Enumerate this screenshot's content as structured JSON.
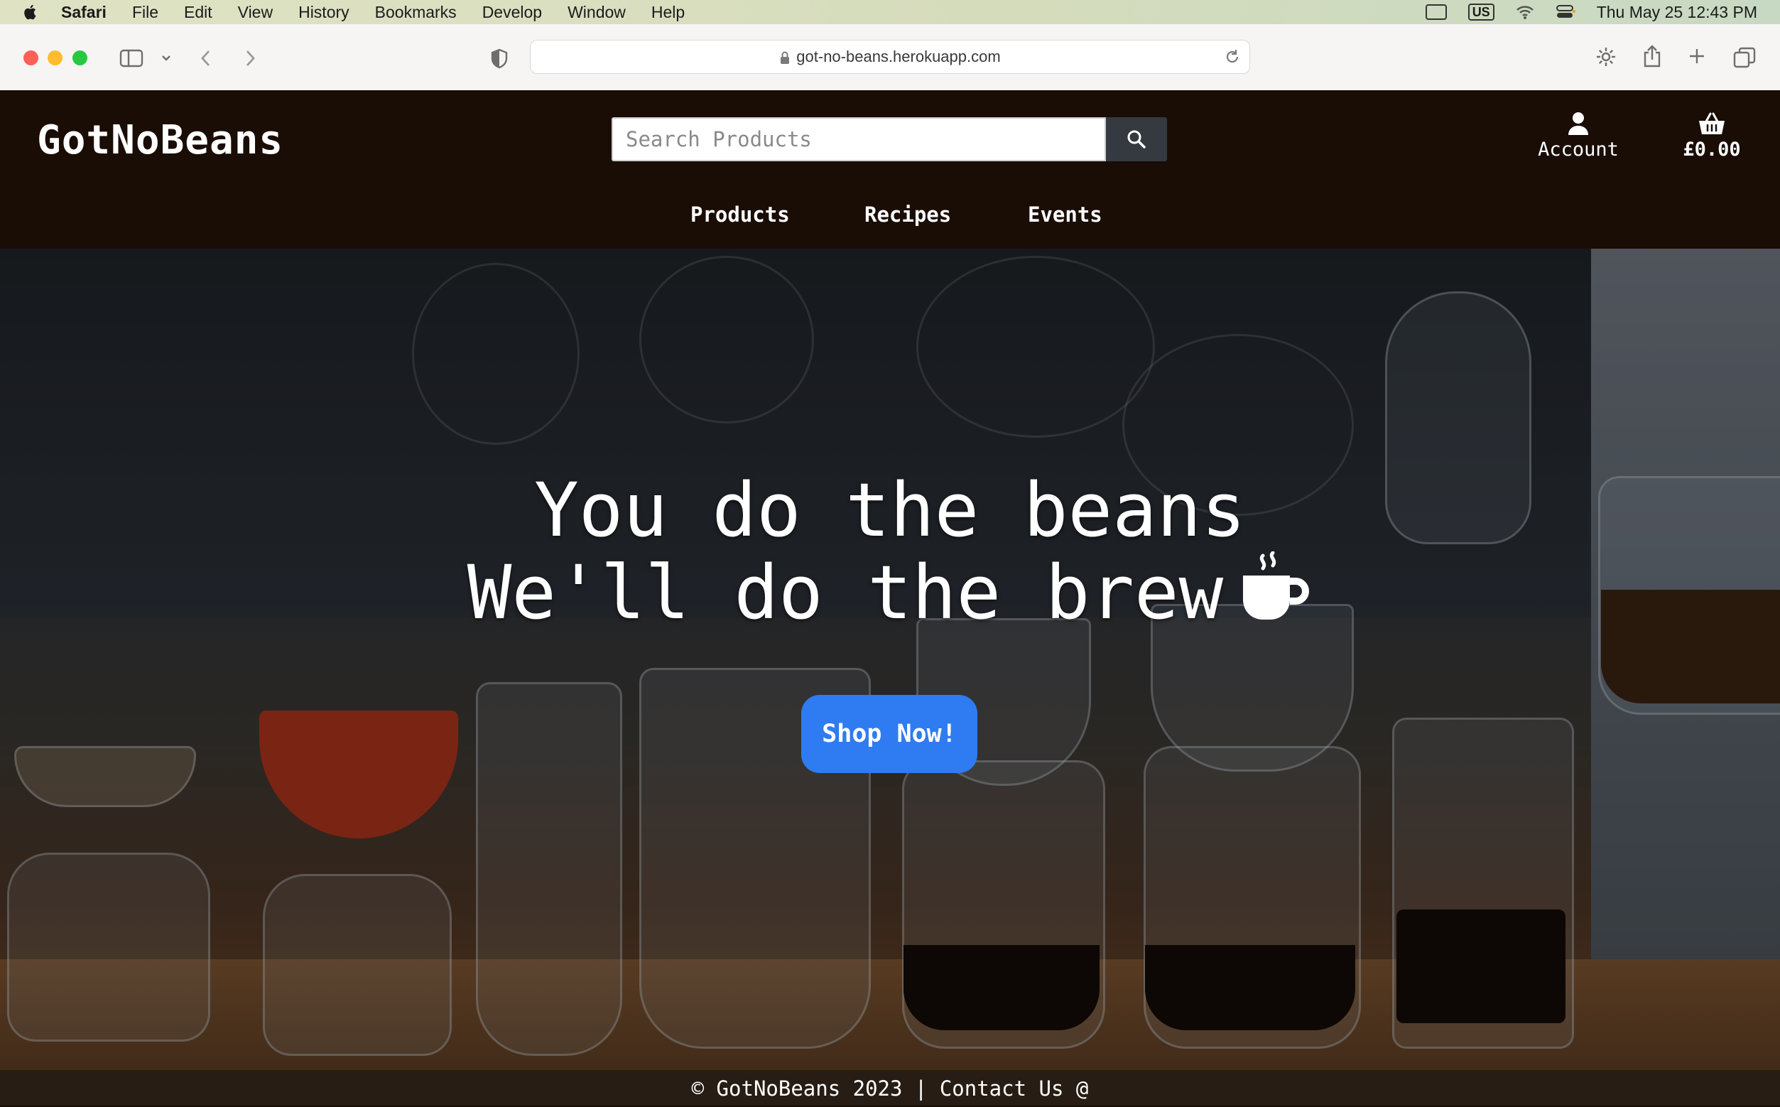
{
  "menubar": {
    "app": "Safari",
    "items": [
      "File",
      "Edit",
      "View",
      "History",
      "Bookmarks",
      "Develop",
      "Window",
      "Help"
    ],
    "keyboard": "US",
    "datetime": "Thu May 25  12:43 PM"
  },
  "browser": {
    "url": "got-no-beans.herokuapp.com"
  },
  "site": {
    "logo": "GotNoBeans",
    "search_placeholder": "Search Products",
    "account_label": "Account",
    "cart_total": "£0.00",
    "nav": [
      "Products",
      "Recipes",
      "Events"
    ]
  },
  "hero": {
    "line1": "You do the beans",
    "line2": "We'll do the brew",
    "button": "Shop Now!"
  },
  "footer": {
    "text": "© GotNoBeans 2023 | Contact Us @"
  },
  "colors": {
    "header_bg": "#190d06",
    "button_blue": "#2f7bf2",
    "search_button": "#343a40"
  }
}
